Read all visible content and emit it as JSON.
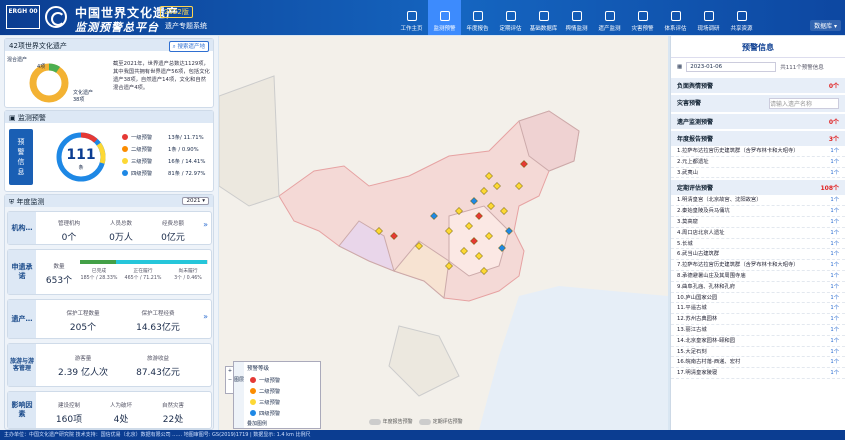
{
  "header": {
    "logo1": "ERGH 00",
    "title1": "中国世界文化遗产",
    "title2": "监测预警总平台",
    "year": "2022版",
    "subtitle": "遗产专题系统",
    "user": "数据库 ▾",
    "nav": [
      "工作主页",
      "监测预警",
      "年度报告",
      "定期评估",
      "基础数据库",
      "舆情监测",
      "遗产监测",
      "灾害预警",
      "体系评估",
      "现场调研",
      "共享资源"
    ],
    "nav_active": 1
  },
  "left": {
    "heritage": {
      "title": "42项世界文化遗产",
      "search": "搜索遗产地",
      "donut_top": "混合遗产",
      "donut_top_n": "4项",
      "donut_bot": "文化遗产",
      "donut_bot_n": "38项",
      "desc": "截至2021年，世界遗产总数达1129项，其中我国共拥有世界遗产56项，包括文化遗产38项，自然遗产14项，文化和自然混合遗产4项。"
    },
    "alert": {
      "title": "监测预警",
      "label": "预警信息",
      "total": "111",
      "unit": "条",
      "levels": [
        {
          "name": "一级预警",
          "val": "13条/ 11.71%",
          "color": "#e53935"
        },
        {
          "name": "二级预警",
          "val": "1条 / 0.90%",
          "color": "#fb8c00"
        },
        {
          "name": "三级预警",
          "val": "16条 / 14.41%",
          "color": "#fdd835"
        },
        {
          "name": "四级预警",
          "val": "81条 / 72.97%",
          "color": "#1e88e5"
        }
      ]
    },
    "annual": {
      "title": "年度监测",
      "year": "2021",
      "org": {
        "label": "机构…",
        "c1": "管理机构",
        "v1": "0个",
        "c2": "人员总数",
        "v2": "0万人",
        "c3": "经费总额",
        "v3": "0亿元"
      },
      "proj": {
        "label": "申遗承诺",
        "c": "数量",
        "v": "653个",
        "s1": "已完成",
        "p1": "185个 / 28.33%",
        "s2": "正在履行",
        "p2": "465个 / 71.21%",
        "s3": "尚未履行",
        "p3": "3个 / 0.46%"
      },
      "protect": {
        "label": "遗产…",
        "c1": "保护工程数量",
        "v1": "205个",
        "c2": "保护工程经费",
        "v2": "14.63亿元"
      },
      "tour": {
        "label": "旅游与游客管理",
        "c1": "游客量",
        "v1": "2.39 亿人次",
        "c2": "旅游收益",
        "v2": "87.43亿元"
      },
      "factor": {
        "label": "影响因素",
        "c1": "建设控制",
        "v1": "160项",
        "c2": "人为破坏",
        "v2": "4处",
        "c3": "自然灾害",
        "v3": "22处"
      }
    }
  },
  "map": {
    "legend_title": "预警等级",
    "legend": [
      "一级预警",
      "二级预警",
      "三级预警",
      "四级预警"
    ],
    "layer_btn": "图层",
    "base": "叠加图例",
    "toggle1": "年度报告预警",
    "toggle2": "定期评估预警"
  },
  "right": {
    "title": "预警信息",
    "date": "2023-01-06",
    "date_hint": "共111个预警信息",
    "search_ph": "请输入遗产名称",
    "sec1": "负面舆情预警",
    "sec1_c": "0个",
    "sec2": "灾害预警",
    "sec3": "遗产监测预警",
    "sec3_c": "0个",
    "sec4": "年度报告预警",
    "sec4_c": "3个",
    "sec4_items": [
      "1.拉萨布达拉宫历史建筑群（含罗布林卡和大昭寺）",
      "2.元上都遗址",
      "3.武夷山"
    ],
    "sec5": "定期评估预警",
    "sec5_c": "108个",
    "sec5_items": [
      "1.明清皇宫（北京故宫、沈阳故宫）",
      "2.秦始皇陵及兵马俑坑",
      "3.莫高窟",
      "4.周口店北京人遗址",
      "5.长城",
      "6.武当山古建筑群",
      "7.拉萨布达拉宫历史建筑群（含罗布林卡和大昭寺）",
      "8.承德避暑山庄及其周围寺庙",
      "9.曲阜孔庙、孔林和孔府",
      "10.庐山国家公园",
      "11.平遥古城",
      "12.苏州古典园林",
      "13.丽江古城",
      "14.北京皇家园林-颐和园",
      "15.大足石刻",
      "16.皖南古村落-西递、宏村",
      "17.明清皇家陵寝"
    ],
    "badge": "1个"
  },
  "footer": "主办单位：中国文化遗产研究院    技术支持：国信优易（北京）数据有限公司    ……    地图审图号: GS(2019)1719 | 数据显示: 1.4 km 比例尺"
}
